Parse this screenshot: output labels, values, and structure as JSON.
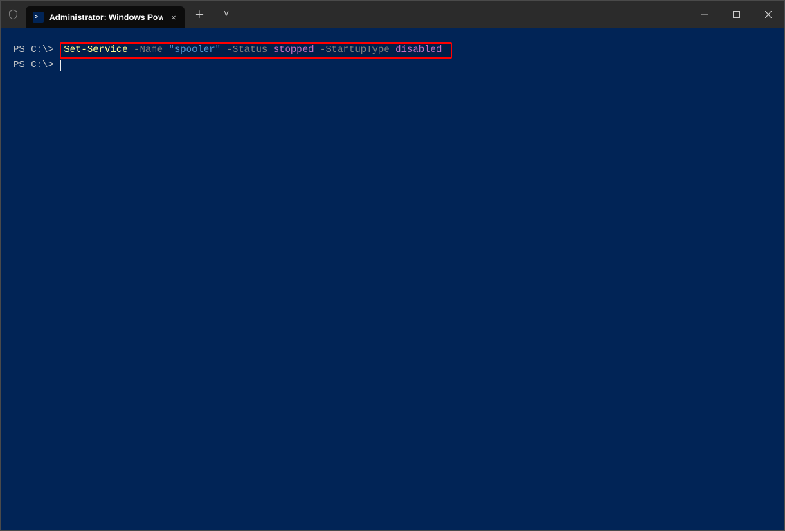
{
  "titlebar": {
    "tab_title": "Administrator: Windows Powe",
    "tab_close_glyph": "✕",
    "new_tab_glyph": "＋",
    "dropdown_glyph": "˅",
    "minimize_glyph": "—",
    "maximize_glyph": "▢",
    "close_glyph": "✕",
    "ps_glyph": ">_"
  },
  "terminal": {
    "prompt": "PS C:\\> ",
    "line1": {
      "cmdlet": "Set-Service",
      "p_name": " -Name",
      "v_name": " \"spooler\"",
      "p_status": " -Status",
      "v_status": " stopped",
      "p_startup": " -StartupType",
      "v_startup": " disabled"
    }
  }
}
